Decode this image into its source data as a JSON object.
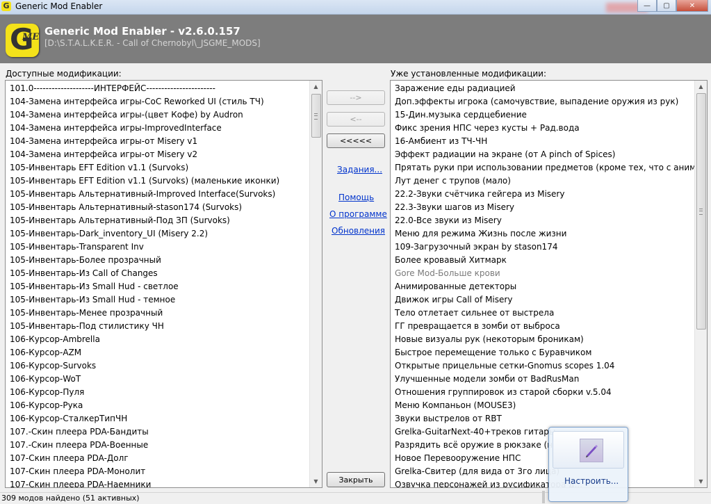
{
  "window": {
    "title": "Generic Mod Enabler",
    "app_icon_letter": "G",
    "buttons": {
      "minimize": "—",
      "maximize": "▢",
      "close": "✕"
    }
  },
  "banner": {
    "logo_letter": "G",
    "logo_sub": "ME",
    "title": "Generic Mod Enabler - v2.6.0.157",
    "path": "[D:\\S.T.A.L.K.E.R. - Call of Chernobyl\\_JSGME_MODS]"
  },
  "available": {
    "label": "Доступные модификации:",
    "items": [
      "101.0--------------------ИНТЕРФЕЙС-----------------------",
      "104-Замена интерфейса игры-CoC Reworked UI (стиль ТЧ)",
      "104-Замена интерфейса игры-(цвет Кофе) by Audron",
      "104-Замена интерфейса игры-ImprovedInterface",
      "104-Замена интерфейса игры-от Misery v1",
      "104-Замена интерфейса игры-от Misery v2",
      "105-Инвентарь EFT Edition v1.1 (Survoks)",
      "105-Инвентарь EFT Edition v1.1 (Survoks) (маленькие иконки)",
      "105-Инвентарь Альтернативный-Improved Interface(Survoks)",
      "105-Инвентарь Альтернативный-stason174 (Survoks)",
      "105-Инвентарь Альтернативный-Под ЗП (Survoks)",
      "105-Инвентарь-Dark_inventory_UI (Misery 2.2)",
      "105-Инвентарь-Transparent Inv",
      "105-Инвентарь-Более прозрачный",
      "105-Инвентарь-Из Call of Changes",
      "105-Инвентарь-Из Small Hud - светлое",
      "105-Инвентарь-Из Small Hud - темное",
      "105-Инвентарь-Менее прозрачный",
      "105-Инвентарь-Под стилистику ЧН",
      "106-Курсор-Ambrella",
      "106-Курсор-AZM",
      "106-Курсор-Survoks",
      "106-Курсор-WoT",
      "106-Курсор-Пуля",
      "106-Курсор-Рука",
      "106-Курсор-СталкерТипЧН",
      "107.-Скин плеера PDA-Бандиты",
      "107.-Скин плеера PDA-Военные",
      "107-Скин плеера PDA-Долг",
      "107-Скин плеера PDA-Монолит",
      "107-Скин плеера PDA-Наемники"
    ]
  },
  "installed": {
    "label": "Уже установленные модификации:",
    "items": [
      {
        "text": "Заражение еды радиацией",
        "grey": false
      },
      {
        "text": "Доп.эффекты игрока (самочувствие, выпадение оружия из рук)",
        "grey": false
      },
      {
        "text": "15-Дин.музыка сердцебиение",
        "grey": false
      },
      {
        "text": "Фикс зрения НПС через кусты + Рад.вода",
        "grey": false
      },
      {
        "text": "16-Амбиент из ТЧ-ЧН",
        "grey": false
      },
      {
        "text": "Эффект радиации на экране (от A pinch of Spices)",
        "grey": false
      },
      {
        "text": "Прятать руки при использовании предметов (кроме тех, что с анимацией)",
        "grey": false
      },
      {
        "text": "Лут денег с трупов (мало)",
        "grey": false
      },
      {
        "text": "22.2-Звуки счётчика гейгера из Misery",
        "grey": false
      },
      {
        "text": "22.3-Звуки шагов из Misery",
        "grey": false
      },
      {
        "text": "22.0-Все звуки из Misery",
        "grey": false
      },
      {
        "text": "Меню для режима Жизнь после жизни",
        "grey": false
      },
      {
        "text": "109-Загрузочный экран by stason174",
        "grey": false
      },
      {
        "text": "Более кровавый Хитмарк",
        "grey": false
      },
      {
        "text": "Gore Mod-Больше крови",
        "grey": true
      },
      {
        "text": "Анимированные детекторы",
        "grey": false
      },
      {
        "text": "Движок игры Call of Misery",
        "grey": false
      },
      {
        "text": "Тело отлетает сильнее от выстрела",
        "grey": false
      },
      {
        "text": "ГГ превращается в зомби от выброса",
        "grey": false
      },
      {
        "text": "Новые визуалы рук (некоторым броникам)",
        "grey": false
      },
      {
        "text": "Быстрое перемещение только с Буравчиком",
        "grey": false
      },
      {
        "text": "Открытые прицельные сетки-Gnomus scopes 1.04",
        "grey": false
      },
      {
        "text": "Улучшенные модели зомби от BadRusMan",
        "grey": false
      },
      {
        "text": "Отношения группировок из старой сборки v.5.04",
        "grey": false
      },
      {
        "text": "Меню Компаньон (MOUSE3)",
        "grey": false
      },
      {
        "text": "Звуки выстрелов от RBT",
        "grey": false
      },
      {
        "text": "Grelka-GuitarNext-40+треков гитары",
        "grey": false
      },
      {
        "text": "Разрядить всё оружие в рюкзаке (на U)",
        "grey": false
      },
      {
        "text": "Новое Перевооружение НПС",
        "grey": false
      },
      {
        "text": "Grelka-Свитер (для вида от 3го лица)",
        "grey": false
      },
      {
        "text": "Озвучка персонажей из русификатора д...",
        "grey": false
      }
    ]
  },
  "buttons": {
    "enable": "-->",
    "disable": "<--",
    "disable_all": "<<<<<",
    "close": "Закрыть"
  },
  "links": {
    "tasks": "Задания...",
    "help": "Помощь",
    "about": "О программе",
    "updates": "Обновления"
  },
  "status": {
    "text": "309 модов найдено (51 активных)"
  },
  "popup": {
    "configure": "Настроить..."
  },
  "colors": {
    "banner": "#7d7d7d",
    "logo": "#f4e21a",
    "link": "#0033cc",
    "grey_item": "#7a7a7a"
  }
}
